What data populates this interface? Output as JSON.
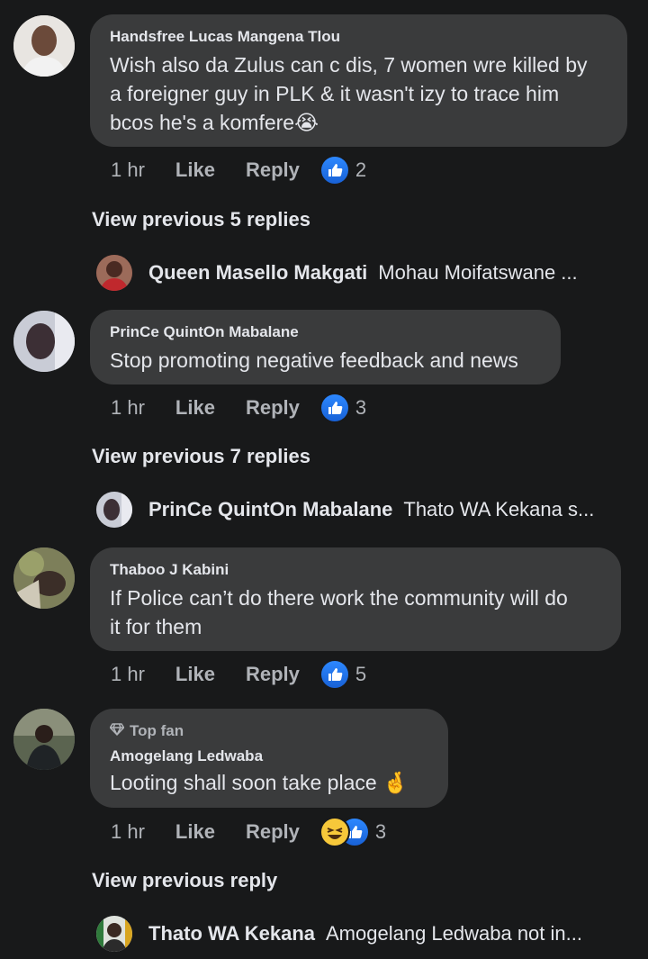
{
  "comments": [
    {
      "author": "Handsfree Lucas Mangena Tlou",
      "text_lines": [
        "Wish also da Zulus can c dis, 7 women wre killed by",
        "a foreigner guy in PLK & it wasn't izy to trace him",
        "bcos he's a komfere"
      ],
      "emoji": "😭",
      "time": "1 hr",
      "like": "Like",
      "reply": "Reply",
      "reactions": "2",
      "view_previous": "View previous 5 replies",
      "last_reply": {
        "name": "Queen Masello Makgati",
        "text": "Mohau Moifatswane ..."
      }
    },
    {
      "author": "PrinCe QuintOn Mabalane",
      "text_lines": [
        "Stop promoting negative feedback and news"
      ],
      "time": "1 hr",
      "like": "Like",
      "reply": "Reply",
      "reactions": "3",
      "view_previous": "View previous 7 replies",
      "last_reply": {
        "name": "PrinCe QuintOn Mabalane",
        "text": "Thato WA Kekana s..."
      }
    },
    {
      "author": "Thaboo J Kabini",
      "text_lines": [
        "If Police can’t do there work the community will do",
        "it for them"
      ],
      "time": "1 hr",
      "like": "Like",
      "reply": "Reply",
      "reactions": "5"
    },
    {
      "badge": "Top fan",
      "author": "Amogelang Ledwaba",
      "text_lines": [
        "Looting shall soon take place"
      ],
      "emoji": "🤞",
      "time": "1 hr",
      "like": "Like",
      "reply": "Reply",
      "reactions": "3",
      "view_previous": "View previous reply",
      "last_reply": {
        "name": "Thato WA Kekana",
        "text": "Amogelang Ledwaba not in..."
      }
    }
  ],
  "icons": {
    "like": "like-thumb-icon",
    "haha": "haha-emoji-icon",
    "topfan": "diamond-icon"
  },
  "colors": {
    "background": "#18191a",
    "bubble": "#3a3b3c",
    "like_blue": "#2d88ff",
    "muted": "#b0b3b8"
  }
}
